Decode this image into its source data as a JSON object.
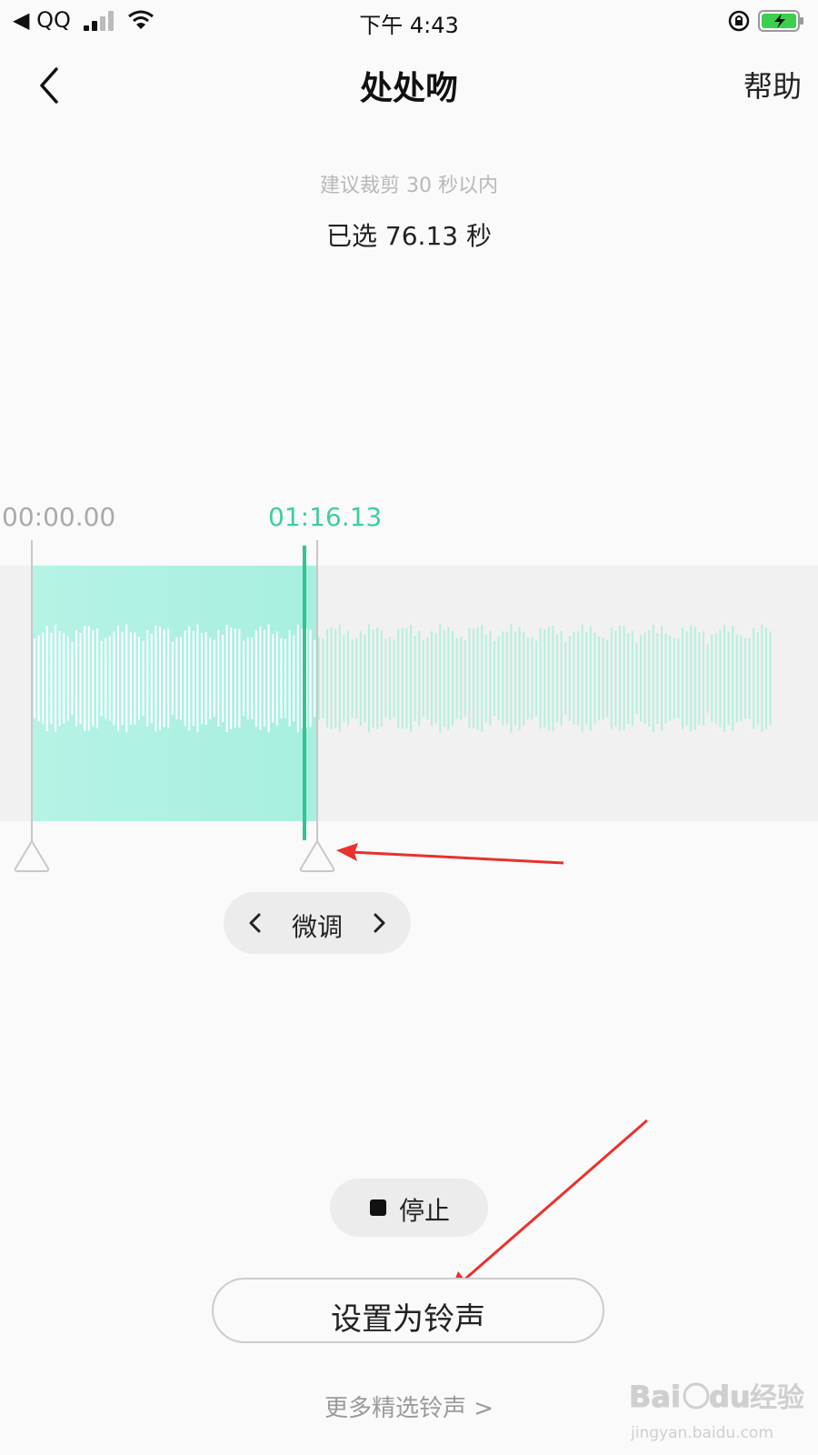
{
  "status_bar": {
    "carrier": "◀ QQ",
    "time": "下午 4:43"
  },
  "nav": {
    "title": "处处吻",
    "help_label": "帮助"
  },
  "trim": {
    "hint": "建议裁剪 30 秒以内",
    "selected_text": "已选 76.13 秒",
    "start_time": "00:00.00",
    "end_time": "01:16.13"
  },
  "finetune": {
    "label": "微调"
  },
  "playback": {
    "stop_label": "停止"
  },
  "actions": {
    "set_ringtone_label": "设置为铃声",
    "more_ringtones": "更多精选铃声 >"
  },
  "watermark": {
    "brand": "Baidu",
    "brand_cn": "经验",
    "url": "jingyan.baidu.com"
  },
  "colors": {
    "accent": "#2fc58f",
    "selection": "#b5f3e5",
    "annotation_arrow": "#e8322c"
  }
}
